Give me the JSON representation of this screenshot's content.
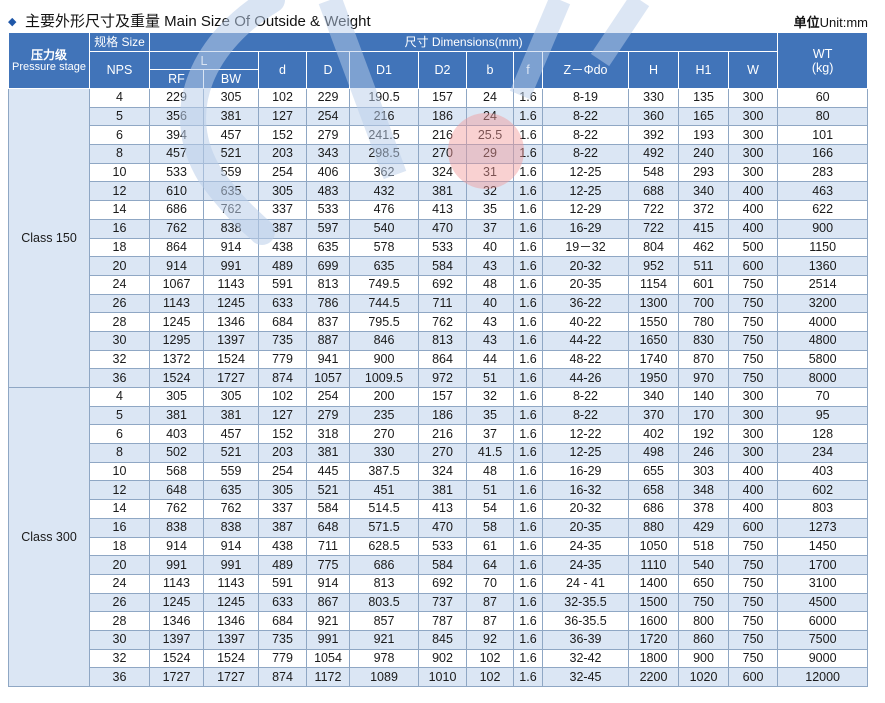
{
  "title": {
    "marker": "◆",
    "text": "主要外形尺寸及重量  Main Size Of Outside & Weight",
    "unit_label": "单位",
    "unit_value": "Unit:mm"
  },
  "header": {
    "pressure_zh": "压力级",
    "pressure_en": "Pressure stage",
    "size_group": "规格 Size",
    "dimensions_group": "尺寸 Dimensions(mm)",
    "nps": "NPS",
    "L": "L",
    "RF": "RF",
    "BW": "BW",
    "d": "d",
    "D": "D",
    "D1": "D1",
    "D2": "D2",
    "b": "b",
    "f": "f",
    "Z": "Z－Φdo",
    "H": "H",
    "H1": "H1",
    "W": "W",
    "wt": "WT",
    "wt_unit": "(kg)"
  },
  "groups": [
    {
      "class": "Class 150",
      "rows": [
        [
          "4",
          "229",
          "305",
          "102",
          "229",
          "190.5",
          "157",
          "24",
          "1.6",
          "8-19",
          "330",
          "135",
          "300",
          "60"
        ],
        [
          "5",
          "356",
          "381",
          "127",
          "254",
          "216",
          "186",
          "24",
          "1.6",
          "8-22",
          "360",
          "165",
          "300",
          "80"
        ],
        [
          "6",
          "394",
          "457",
          "152",
          "279",
          "241.5",
          "216",
          "25.5",
          "1.6",
          "8-22",
          "392",
          "193",
          "300",
          "101"
        ],
        [
          "8",
          "457",
          "521",
          "203",
          "343",
          "298.5",
          "270",
          "29",
          "1.6",
          "8-22",
          "492",
          "240",
          "300",
          "166"
        ],
        [
          "10",
          "533",
          "559",
          "254",
          "406",
          "362",
          "324",
          "31",
          "1.6",
          "12-25",
          "548",
          "293",
          "300",
          "283"
        ],
        [
          "12",
          "610",
          "635",
          "305",
          "483",
          "432",
          "381",
          "32",
          "1.6",
          "12-25",
          "688",
          "340",
          "400",
          "463"
        ],
        [
          "14",
          "686",
          "762",
          "337",
          "533",
          "476",
          "413",
          "35",
          "1.6",
          "12-29",
          "722",
          "372",
          "400",
          "622"
        ],
        [
          "16",
          "762",
          "838",
          "387",
          "597",
          "540",
          "470",
          "37",
          "1.6",
          "16-29",
          "722",
          "415",
          "400",
          "900"
        ],
        [
          "18",
          "864",
          "914",
          "438",
          "635",
          "578",
          "533",
          "40",
          "1.6",
          "19－32",
          "804",
          "462",
          "500",
          "1150"
        ],
        [
          "20",
          "914",
          "991",
          "489",
          "699",
          "635",
          "584",
          "43",
          "1.6",
          "20-32",
          "952",
          "511",
          "600",
          "1360"
        ],
        [
          "24",
          "1067",
          "1143",
          "591",
          "813",
          "749.5",
          "692",
          "48",
          "1.6",
          "20-35",
          "1154",
          "601",
          "750",
          "2514"
        ],
        [
          "26",
          "1143",
          "1245",
          "633",
          "786",
          "744.5",
          "711",
          "40",
          "1.6",
          "36-22",
          "1300",
          "700",
          "750",
          "3200"
        ],
        [
          "28",
          "1245",
          "1346",
          "684",
          "837",
          "795.5",
          "762",
          "43",
          "1.6",
          "40-22",
          "1550",
          "780",
          "750",
          "4000"
        ],
        [
          "30",
          "1295",
          "1397",
          "735",
          "887",
          "846",
          "813",
          "43",
          "1.6",
          "44-22",
          "1650",
          "830",
          "750",
          "4800"
        ],
        [
          "32",
          "1372",
          "1524",
          "779",
          "941",
          "900",
          "864",
          "44",
          "1.6",
          "48-22",
          "1740",
          "870",
          "750",
          "5800"
        ],
        [
          "36",
          "1524",
          "1727",
          "874",
          "1057",
          "1009.5",
          "972",
          "51",
          "1.6",
          "44-26",
          "1950",
          "970",
          "750",
          "8000"
        ]
      ]
    },
    {
      "class": "Class 300",
      "rows": [
        [
          "4",
          "305",
          "305",
          "102",
          "254",
          "200",
          "157",
          "32",
          "1.6",
          "8-22",
          "340",
          "140",
          "300",
          "70"
        ],
        [
          "5",
          "381",
          "381",
          "127",
          "279",
          "235",
          "186",
          "35",
          "1.6",
          "8-22",
          "370",
          "170",
          "300",
          "95"
        ],
        [
          "6",
          "403",
          "457",
          "152",
          "318",
          "270",
          "216",
          "37",
          "1.6",
          "12-22",
          "402",
          "192",
          "300",
          "128"
        ],
        [
          "8",
          "502",
          "521",
          "203",
          "381",
          "330",
          "270",
          "41.5",
          "1.6",
          "12-25",
          "498",
          "246",
          "300",
          "234"
        ],
        [
          "10",
          "568",
          "559",
          "254",
          "445",
          "387.5",
          "324",
          "48",
          "1.6",
          "16-29",
          "655",
          "303",
          "400",
          "403"
        ],
        [
          "12",
          "648",
          "635",
          "305",
          "521",
          "451",
          "381",
          "51",
          "1.6",
          "16-32",
          "658",
          "348",
          "400",
          "602"
        ],
        [
          "14",
          "762",
          "762",
          "337",
          "584",
          "514.5",
          "413",
          "54",
          "1.6",
          "20-32",
          "686",
          "378",
          "400",
          "803"
        ],
        [
          "16",
          "838",
          "838",
          "387",
          "648",
          "571.5",
          "470",
          "58",
          "1.6",
          "20-35",
          "880",
          "429",
          "600",
          "1273"
        ],
        [
          "18",
          "914",
          "914",
          "438",
          "711",
          "628.5",
          "533",
          "61",
          "1.6",
          "24-35",
          "1050",
          "518",
          "750",
          "1450"
        ],
        [
          "20",
          "991",
          "991",
          "489",
          "775",
          "686",
          "584",
          "64",
          "1.6",
          "24-35",
          "1110",
          "540",
          "750",
          "1700"
        ],
        [
          "24",
          "1143",
          "1143",
          "591",
          "914",
          "813",
          "692",
          "70",
          "1.6",
          "24 - 41",
          "1400",
          "650",
          "750",
          "3100"
        ],
        [
          "26",
          "1245",
          "1245",
          "633",
          "867",
          "803.5",
          "737",
          "87",
          "1.6",
          "32-35.5",
          "1500",
          "750",
          "750",
          "4500"
        ],
        [
          "28",
          "1346",
          "1346",
          "684",
          "921",
          "857",
          "787",
          "87",
          "1.6",
          "36-35.5",
          "1600",
          "800",
          "750",
          "6000"
        ],
        [
          "30",
          "1397",
          "1397",
          "735",
          "991",
          "921",
          "845",
          "92",
          "1.6",
          "36-39",
          "1720",
          "860",
          "750",
          "7500"
        ],
        [
          "32",
          "1524",
          "1524",
          "779",
          "1054",
          "978",
          "902",
          "102",
          "1.6",
          "32-42",
          "1800",
          "900",
          "750",
          "9000"
        ],
        [
          "36",
          "1727",
          "1727",
          "874",
          "1172",
          "1089",
          "1010",
          "102",
          "1.6",
          "32-45",
          "2200",
          "1020",
          "600",
          "12000"
        ]
      ]
    }
  ],
  "colors": {
    "header_bg": "#4174b9",
    "row_alt": "#dbe6f4",
    "watermark": "#c8d8ee",
    "highlight": "#f2a0a0"
  }
}
